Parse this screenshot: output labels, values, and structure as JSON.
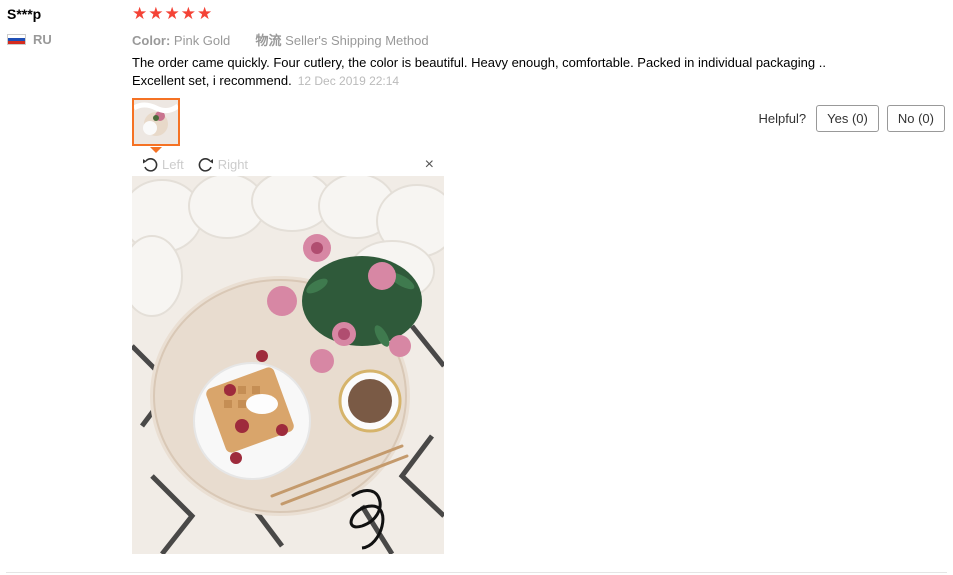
{
  "review": {
    "name": "S***p",
    "country": "RU",
    "rating_stars": 5,
    "sku_color_label": "Color:",
    "sku_color_value": "Pink Gold",
    "shipping_label": "物流",
    "shipping_value": "Seller's Shipping Method",
    "text": "The order came quickly. Four cutlery, the color is beautiful. Heavy enough, comfortable. Packed in individual packaging .. Excellent set, i recommend.",
    "date": "12 Dec 2019 22:14"
  },
  "helpful": {
    "label": "Helpful?",
    "yes": "Yes (0)",
    "no": "No (0)"
  },
  "viewer": {
    "rotate_left": "Left",
    "rotate_right": "Right",
    "close": "×"
  },
  "colors": {
    "star": "#f44336",
    "thumb_border": "#f57224"
  }
}
